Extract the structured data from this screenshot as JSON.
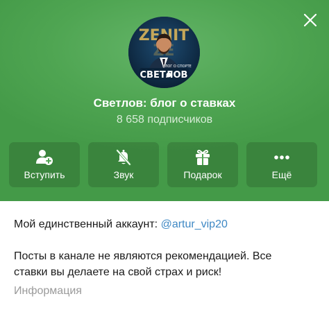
{
  "channel": {
    "title": "Светлов: блог о ставках",
    "subscribers": "8 658 подписчиков",
    "avatar": {
      "top_text": "ZENIT",
      "small_caption": "БЛОГ О СПОРТЕ",
      "name_text": "СВЕТЛОВ"
    }
  },
  "actions": [
    {
      "label": "Вступить",
      "icon": "join-icon"
    },
    {
      "label": "Звук",
      "icon": "bell-off-icon"
    },
    {
      "label": "Подарок",
      "icon": "gift-icon"
    },
    {
      "label": "Ещё",
      "icon": "more-icon"
    }
  ],
  "about": {
    "account_prefix": "Мой единственный аккаунт: ",
    "account_mention": "@artur_vip20",
    "disclaimer_line1": "Посты в канале не являются рекомендацией. Все",
    "disclaimer_line2": "ставки вы делаете на свой страх и риск!",
    "caption": "Информация"
  },
  "colors": {
    "header_green": "#4fa552",
    "mention_blue": "#3e88c4",
    "caption_gray": "#9a9a9a"
  }
}
